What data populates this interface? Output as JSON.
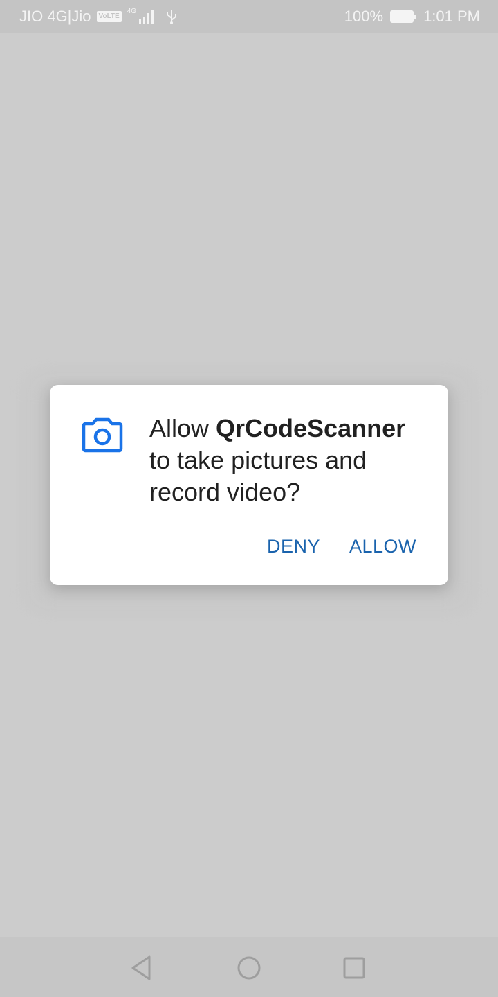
{
  "status_bar": {
    "carrier": "JIO 4G|Jio",
    "volte": "VoLTE",
    "network_tag": "4G",
    "signal_icon": "signal-bars-icon",
    "usb_icon": "usb-icon",
    "battery_percent": "100%",
    "battery_icon": "battery-charging-icon",
    "time": "1:01 PM"
  },
  "dialog": {
    "icon": "camera-icon",
    "message_prefix": "Allow ",
    "app_name": "QrCodeScanner",
    "message_suffix": " to take pictures and record video?",
    "deny_label": "DENY",
    "allow_label": "ALLOW",
    "accent_color": "#1a73e8",
    "button_color": "#1a63ad"
  },
  "nav_bar": {
    "back_icon": "back-triangle-icon",
    "home_icon": "home-circle-icon",
    "recents_icon": "recents-square-icon"
  }
}
